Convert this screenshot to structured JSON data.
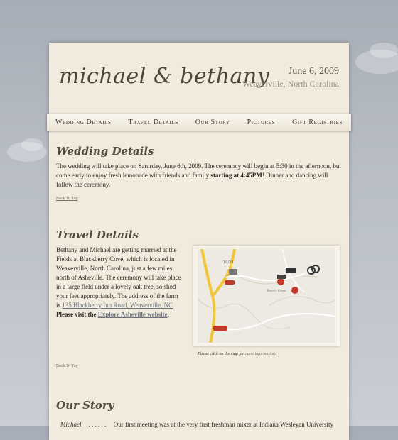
{
  "header": {
    "logo_text": "michael & bethany",
    "date": "June 6, 2009",
    "location": "Weaverville, North Carolina"
  },
  "nav": {
    "items": [
      "Wedding Details",
      "Travel Details",
      "Our Story",
      "Pictures",
      "Gift Registries"
    ]
  },
  "wedding": {
    "title": "Wedding Details",
    "text_before": "The wedding will take place on Saturday, June 6th, 2009. The ceremony will begin at 5:30 in the afternoon, but come early to enjoy fresh lemonade with friends and family ",
    "text_bold": "starting at 4:45PM",
    "text_after": "! Dinner and dancing will follow the ceremony.",
    "back_to_top": "Back To Top"
  },
  "travel": {
    "title": "Travel Details",
    "text": "Bethany and Michael are getting married at the Fields at Blackberry Cove, which is located in Weaverville, North Carolina, just a few miles north of Asheville. The ceremony will take place in a large field under a lovely oak tree, so shod your feet appropriately. The address of the farm is ",
    "address_link": "135 Blackberry Inn Road, Weaverville, NC",
    "address_after": ".",
    "visit_bold": "Please visit the ",
    "visit_link": "Explore Asheville website",
    "visit_after": ".",
    "map_caption": "Please click on the map for ",
    "map_caption_link": "more information",
    "map_caption_after": ".",
    "back_to_top": "Back To Top"
  },
  "story": {
    "title": "Our Story",
    "first_name": "Michael",
    "dots": ". . . . . .",
    "first_line": "Our first meeting was at the very first freshman mixer at Indiana Wesleyan University"
  },
  "colors": {
    "page_bg": "#f1ebdd",
    "accent": "#564c3d",
    "link": "#6b7382"
  }
}
